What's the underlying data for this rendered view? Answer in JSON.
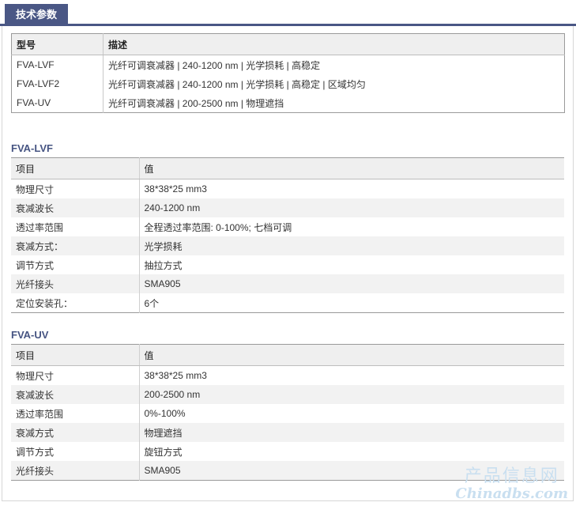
{
  "tab": {
    "label": "技术参数"
  },
  "overview": {
    "headers": [
      "型号",
      "描述"
    ],
    "rows": [
      [
        "FVA-LVF",
        "光纤可调衰减器 | 240-1200 nm | 光学损耗 | 高稳定"
      ],
      [
        "FVA-LVF2",
        "光纤可调衰减器 | 240-1200 nm | 光学损耗 | 高稳定 | 区域均匀"
      ],
      [
        "FVA-UV",
        "光纤可调衰减器 | 200-2500 nm | 物理遮挡"
      ]
    ]
  },
  "spec_lvf": {
    "title": "FVA-LVF",
    "headers": [
      "项目",
      "值"
    ],
    "rows": [
      [
        "物理尺寸",
        "38*38*25 mm3"
      ],
      [
        "衰减波长",
        "240-1200 nm"
      ],
      [
        "透过率范围",
        "全程透过率范围: 0-100%; 七档可调"
      ],
      [
        "衰减方式：",
        "光学损耗"
      ],
      [
        "调节方式",
        "抽拉方式"
      ],
      [
        "光纤接头",
        "SMA905"
      ],
      [
        "定位安装孔：",
        "6个"
      ]
    ]
  },
  "spec_uv": {
    "title": "FVA-UV",
    "headers": [
      "项目",
      "值"
    ],
    "rows": [
      [
        "物理尺寸",
        "38*38*25 mm3"
      ],
      [
        "衰减波长",
        "200-2500 nm"
      ],
      [
        "透过率范围",
        "0%-100%"
      ],
      [
        "衰减方式",
        "物理遮挡"
      ],
      [
        "调节方式",
        "旋钮方式"
      ],
      [
        "光纤接头",
        "SMA905"
      ]
    ]
  },
  "watermark": {
    "line1": "产品信息网",
    "line2": "Chinadbs.com"
  }
}
